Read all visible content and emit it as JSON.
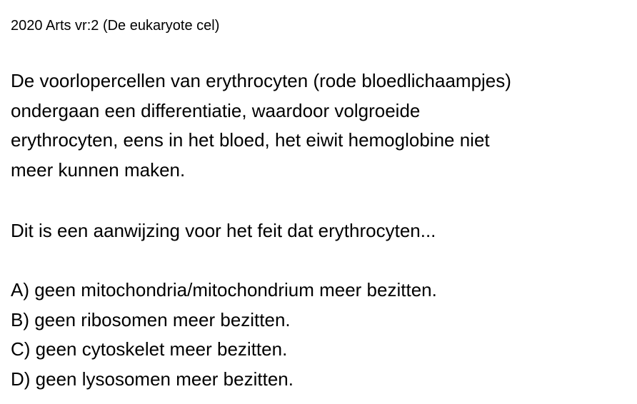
{
  "header": {
    "title": "2020 Arts vr:2 (De eukaryote cel)"
  },
  "question": {
    "lines": [
      "De voorlopercellen van erythrocyten (rode bloedlichaampjes)",
      "ondergaan een differentiatie, waardoor volgroeide",
      "erythrocyten, eens in het bloed, het eiwit hemoglobine niet",
      "meer kunnen maken."
    ],
    "prompt": "Dit is een aanwijzing voor het feit dat erythrocyten..."
  },
  "options": [
    "A) geen mitochondria/mitochondrium meer bezitten.",
    "B) geen ribosomen meer bezitten.",
    "C) geen cytoskelet meer bezitten.",
    "D) geen lysosomen meer bezitten."
  ]
}
